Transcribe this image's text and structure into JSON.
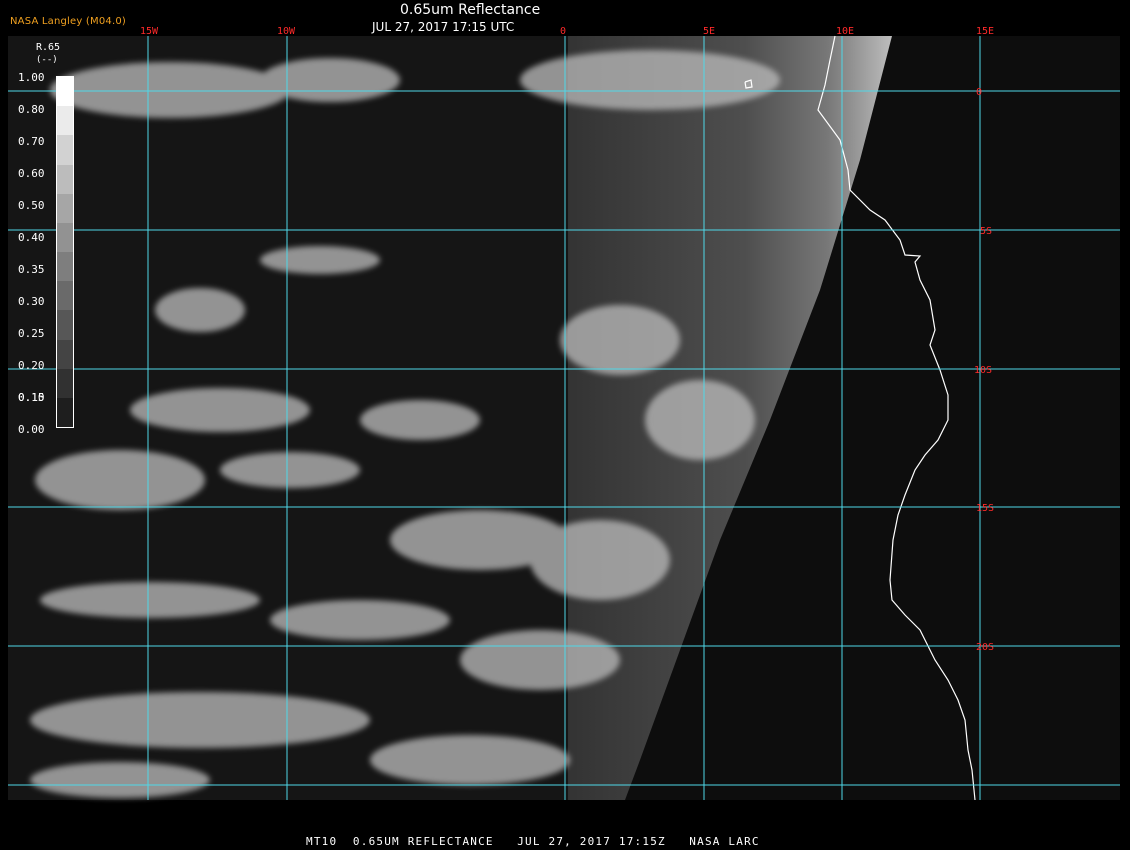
{
  "header": {
    "org": "NASA Langley (M04.0)",
    "title": "0.65um Reflectance",
    "datetime": "JUL 27, 2017 17:15 UTC"
  },
  "legend": {
    "title": "R.65",
    "unit": "(--)",
    "ticks": [
      "1.00",
      "0.80",
      "0.70",
      "0.60",
      "0.50",
      "0.40",
      "0.35",
      "0.30",
      "0.25",
      "0.20",
      "0.15",
      "0.10",
      "0.00"
    ]
  },
  "grid": {
    "longitudes": [
      "15W",
      "10W",
      "0",
      "5E",
      "10E",
      "15E"
    ],
    "latitudes": [
      "0",
      "5S",
      "10S",
      "15S",
      "20S"
    ]
  },
  "footer": {
    "caption": "MT10  0.65UM REFLECTANCE   JUL 27, 2017 17:15Z   NASA LARC"
  },
  "colors": {
    "grid": "#4fd8e8",
    "label": "#ff2a2a",
    "coast": "#ffffff",
    "org": "#f0a020"
  }
}
